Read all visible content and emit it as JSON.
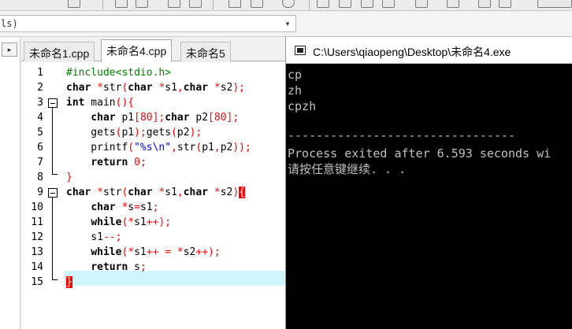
{
  "combo": {
    "text": "ls)"
  },
  "tabs": [
    {
      "label": "未命名1.cpp"
    },
    {
      "label": "未命名4.cpp"
    },
    {
      "label": "未命名5"
    }
  ],
  "editor": {
    "line_numbers": [
      "1",
      "2",
      "3",
      "4",
      "5",
      "6",
      "7",
      "8",
      "9",
      "10",
      "11",
      "12",
      "13",
      "14",
      "15"
    ]
  },
  "console": {
    "title": "C:\\Users\\qiaopeng\\Desktop\\未命名4.exe",
    "lines": [
      "cp",
      "zh",
      "cpzh",
      "",
      "--------------------------------",
      "Process exited after 6.593 seconds wi",
      "请按任意键继续. . ."
    ]
  },
  "icons": {
    "scroll_left": "▸",
    "combo_arrow": "▾"
  }
}
